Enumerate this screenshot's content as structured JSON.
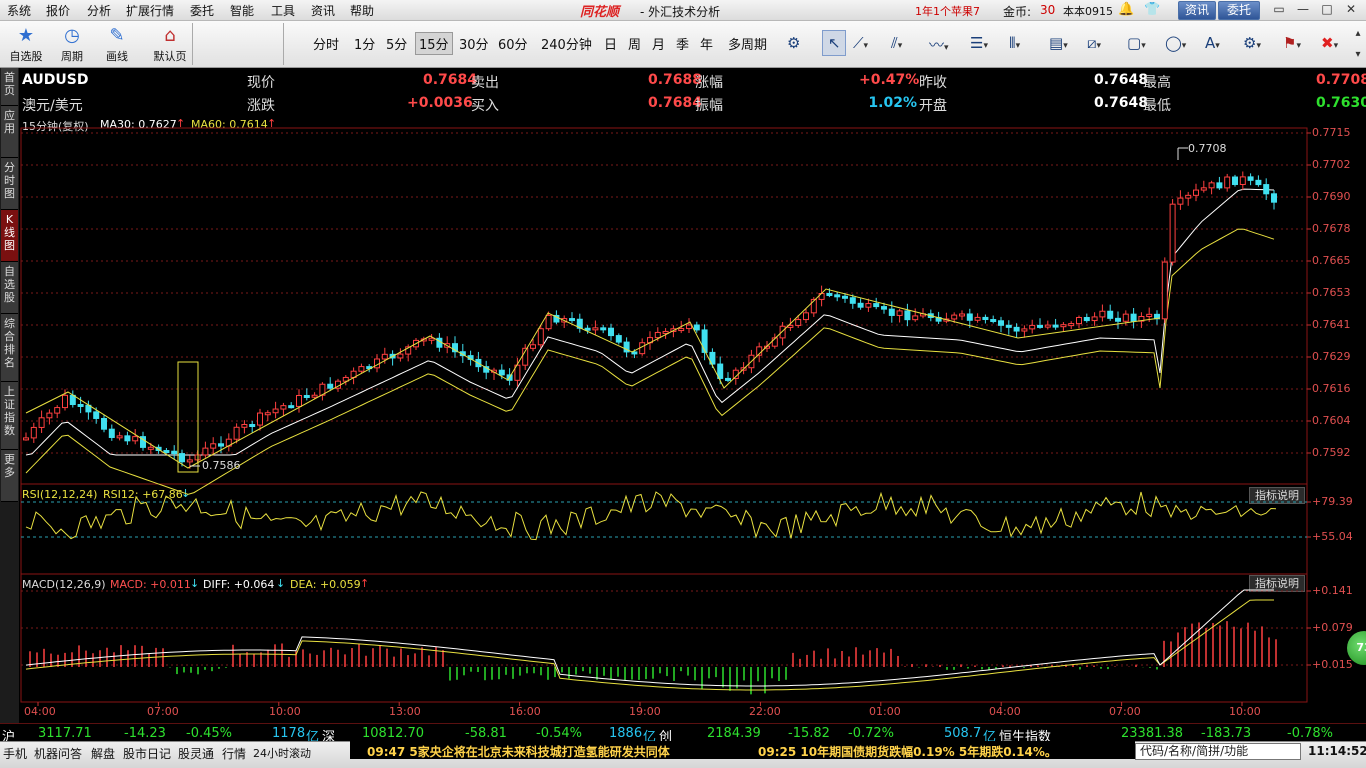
{
  "menu": {
    "items": [
      "系统",
      "报价",
      "分析",
      "扩展行情",
      "委托",
      "智能",
      "工具",
      "资讯",
      "帮助"
    ],
    "brand": "同花顺",
    "window_title": "- 外汇技术分析",
    "promo": "1年1个苹果7",
    "gold_label": "金币:",
    "gold_value": "30",
    "account": "本本0915",
    "news_btn": "资讯",
    "trade_btn": "委托"
  },
  "toolbar": {
    "custom_stock": "自选股",
    "period": "周期",
    "draw": "画线",
    "default": "默认页",
    "periods": [
      "分时",
      "1分",
      "5分",
      "15分",
      "30分",
      "60分",
      "240分钟",
      "日",
      "周",
      "月",
      "季",
      "年",
      "多周期"
    ],
    "active_period": "15分"
  },
  "left_tabs": [
    {
      "label": "首页",
      "active": false
    },
    {
      "label": "应用",
      "active": false
    },
    {
      "label": "分时图",
      "active": false
    },
    {
      "label": "K线图",
      "active": true
    },
    {
      "label": "自选股",
      "active": false
    },
    {
      "label": "综合排名",
      "active": false
    },
    {
      "label": "上证指数",
      "active": false
    },
    {
      "label": "更多",
      "active": false
    }
  ],
  "quote": {
    "code": "AUDUSD",
    "name": "澳元/美元",
    "labels": {
      "price": "现价",
      "change": "涨跌",
      "sell": "卖出",
      "buy": "买入",
      "pct": "涨幅",
      "amplitude": "振幅",
      "prev_close": "昨收",
      "open": "开盘",
      "high": "最高",
      "low": "最低"
    },
    "price": "0.7684",
    "change": "+0.0036",
    "sell": "0.7688",
    "buy": "0.7684",
    "pct": "+0.47%",
    "amplitude": "1.02%",
    "prev_close": "0.7648",
    "open": "0.7648",
    "high": "0.7708",
    "low": "0.7630"
  },
  "kline": {
    "period_label": "15分钟(复权)",
    "ma30_label": "MA30: 0.7627",
    "ma60_label": "MA60: 0.7614",
    "high_mark": "0.7708",
    "low_mark": "0.7586",
    "price_axis": [
      "0.7715",
      "0.7702",
      "0.7690",
      "0.7678",
      "0.7665",
      "0.7653",
      "0.7641",
      "0.7629",
      "0.7616",
      "0.7604",
      "0.7592"
    ]
  },
  "rsi": {
    "label": "RSI(12,12,24)",
    "value_label": "RSI12: +67.86",
    "help": "指标说明",
    "axis": [
      "+79.39",
      "+55.04"
    ]
  },
  "macd": {
    "label": "MACD(12,26,9)",
    "macd_value": "MACD: +0.011",
    "diff_value": "DIFF: +0.064",
    "dea_value": "DEA: +0.059",
    "help": "指标说明",
    "axis": [
      "+0.141",
      "+0.079",
      "+0.015"
    ]
  },
  "time_axis": [
    "04:00",
    "07:00",
    "10:00",
    "13:00",
    "16:00",
    "19:00",
    "22:00",
    "01:00",
    "04:00",
    "07:00",
    "10:00"
  ],
  "ticker": {
    "sh_label": "沪",
    "sh_index": "3117.71",
    "sh_change": "-14.23",
    "sh_pct": "-0.45%",
    "sh_amount": "1178",
    "sh_unit": "亿",
    "sz_label": "深",
    "sz_index": "10812.70",
    "sz_change": "-58.81",
    "sz_pct": "-0.54%",
    "sz_amount": "1886",
    "sz_unit": "亿",
    "cy_label": "创",
    "cy_index": "2184.39",
    "cy_change": "-15.82",
    "cy_pct": "-0.72%",
    "cy_amount": "508.7",
    "cy_unit": "亿",
    "hs_label": "恒生指数",
    "hs_index": "23381.38",
    "hs_change": "-183.73",
    "hs_pct": "-0.78%"
  },
  "statusbar": {
    "items": [
      "手机",
      "机器问答",
      "解盘",
      "股市日记",
      "股灵通",
      "行情",
      "24小时滚动"
    ],
    "news1": "09:47 5家央企将在北京未来科技城打造氢能研发共同体",
    "news2": "09:25 10年期国债期货跌幅0.19% 5年期跌0.14%。",
    "search_placeholder": "代码/名称/简拼/功能",
    "clock": "11:14:52"
  },
  "side_badge": "73",
  "colors": {
    "up": "#ff4040",
    "down": "#40e0f0",
    "ma30": "#ffffff",
    "ma60": "#e8e040",
    "rsi": "#e8e040",
    "grid": "#7a1a1a"
  }
}
